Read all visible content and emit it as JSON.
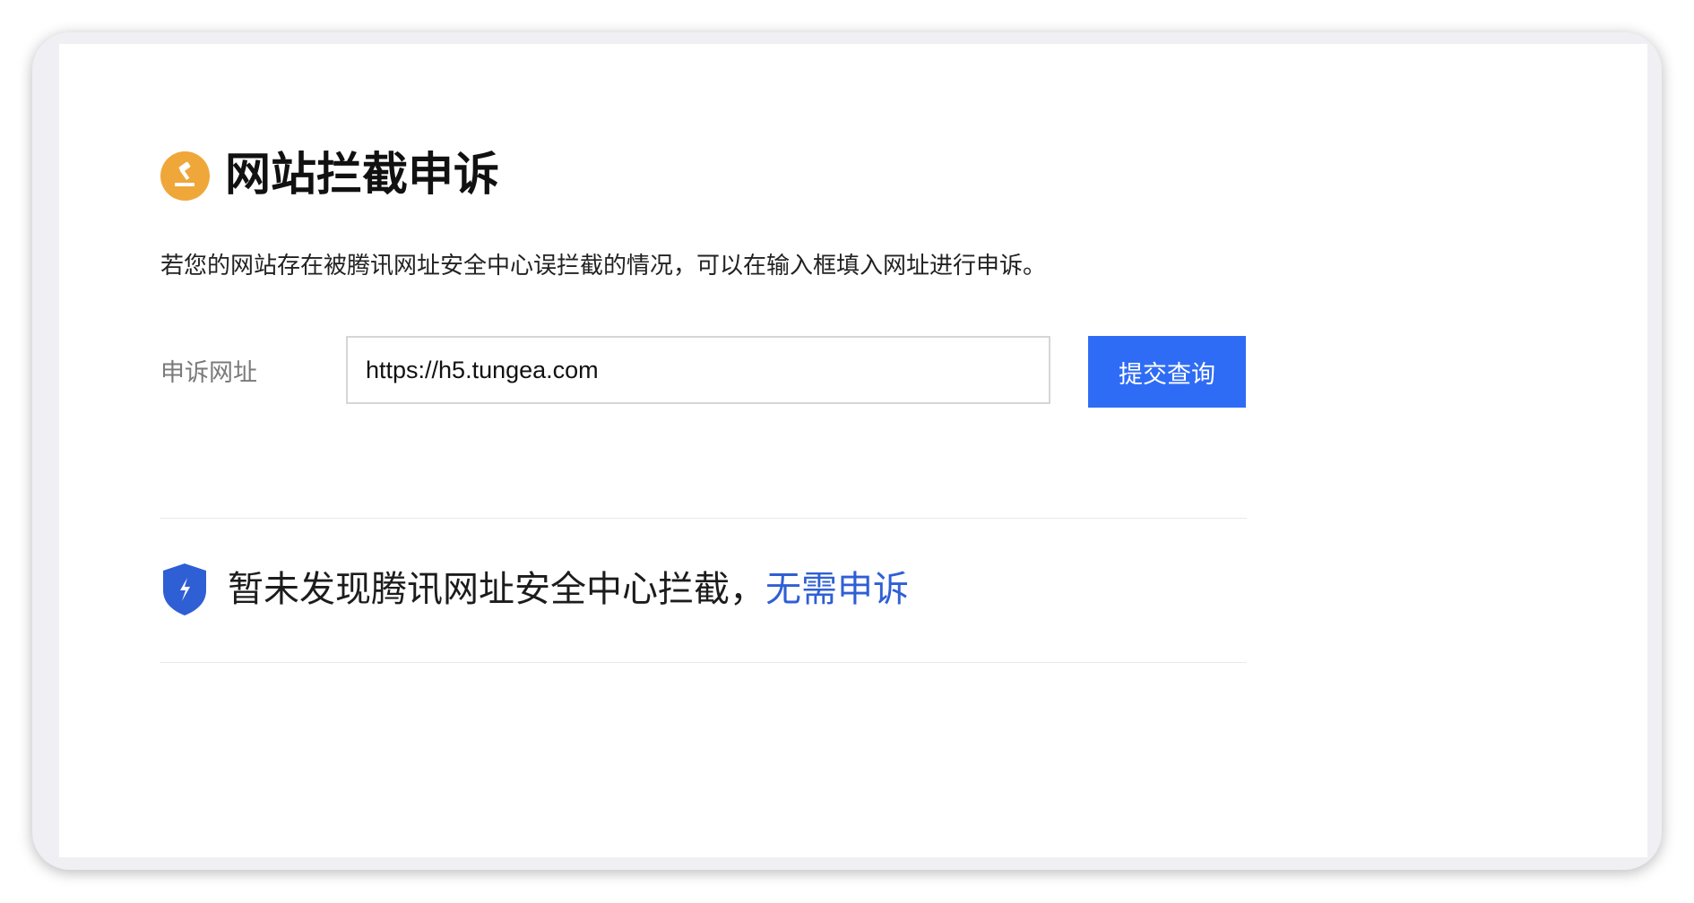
{
  "page": {
    "title": "网站拦截申诉",
    "description": "若您的网站存在被腾讯网址安全中心误拦截的情况，可以在输入框填入网址进行申诉。"
  },
  "form": {
    "label": "申诉网址",
    "url_value": "https://h5.tungea.com",
    "submit_label": "提交查询"
  },
  "result": {
    "message": "暂未发现腾讯网址安全中心拦截，",
    "link_text": "无需申诉"
  },
  "icons": {
    "title_icon": "gavel-icon",
    "result_icon": "shield-icon"
  },
  "colors": {
    "accent": "#2f6cf5",
    "link": "#2f5fd4",
    "title_icon_bg": "#f0a73a",
    "shield": "#2f5fd4"
  }
}
